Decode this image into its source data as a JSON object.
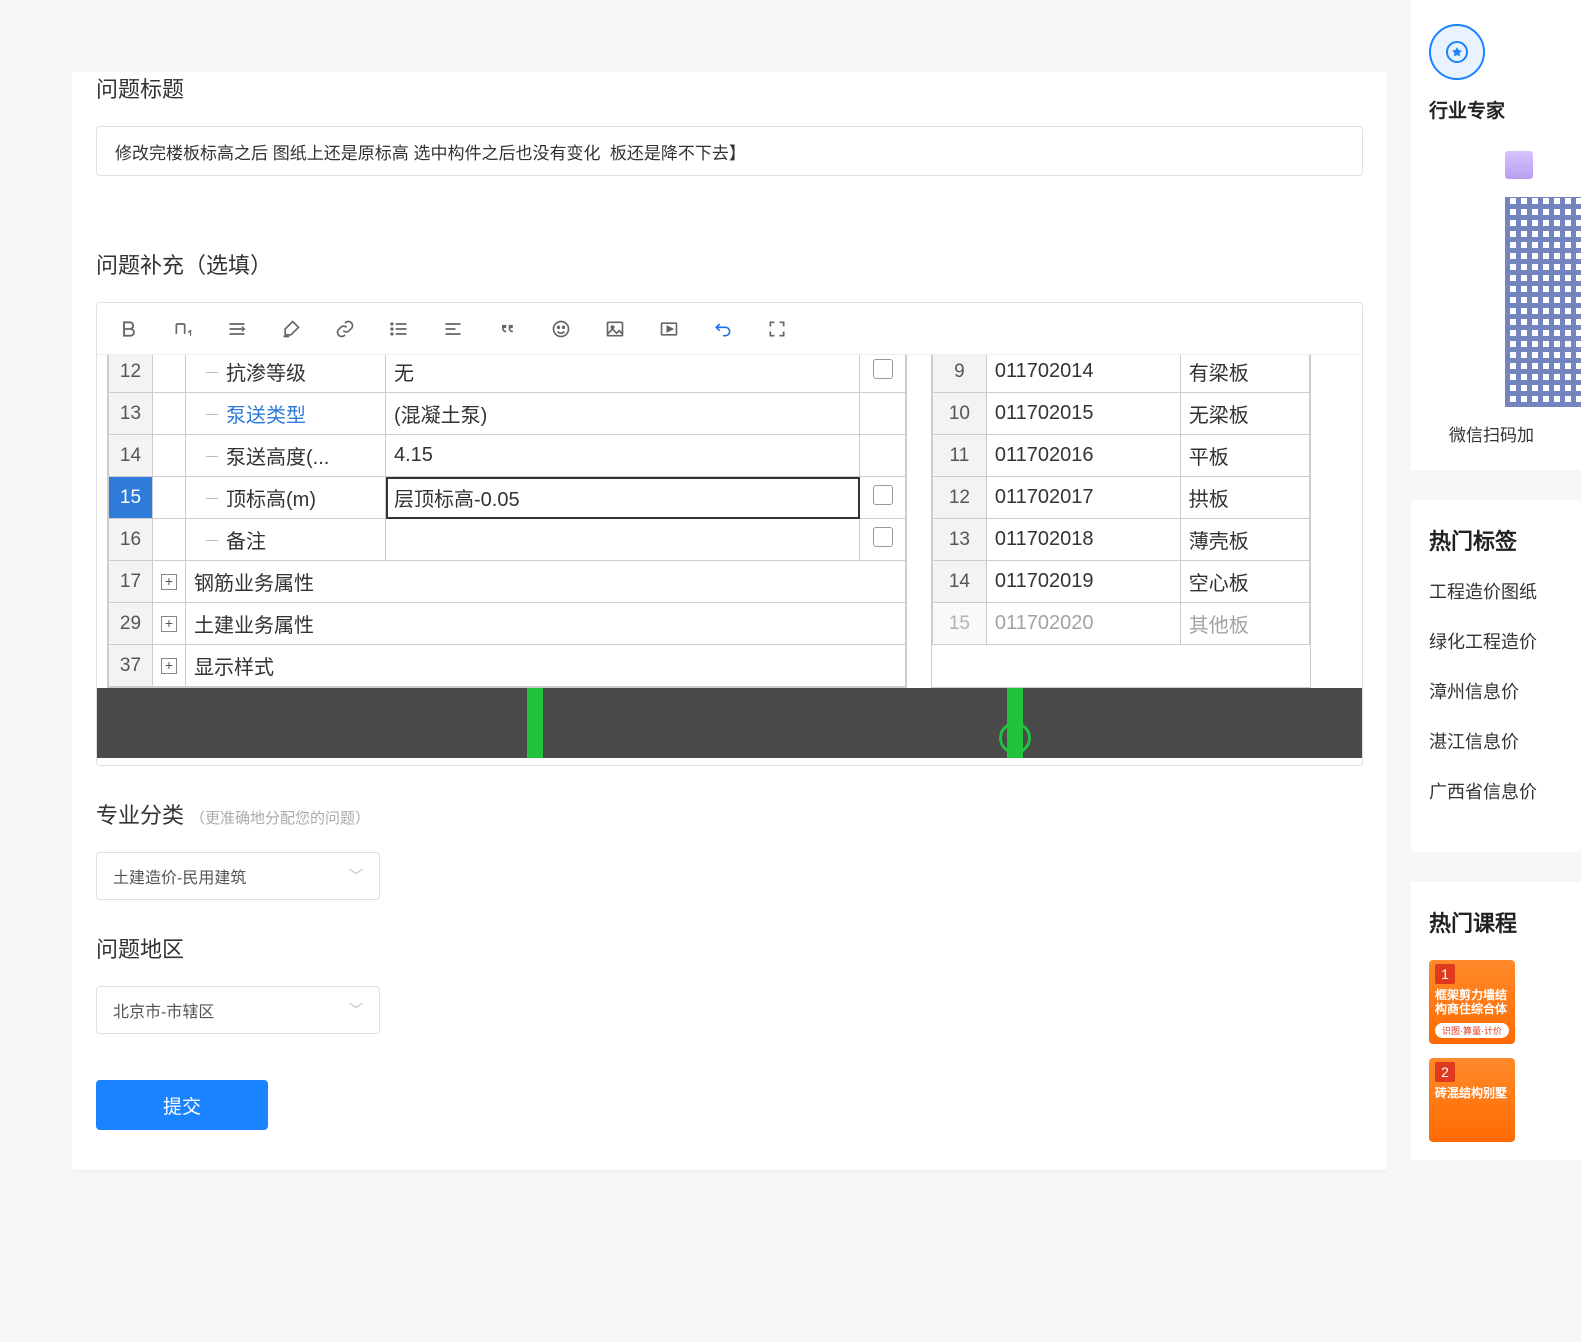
{
  "form": {
    "title_label": "问题标题",
    "title_value": "修改完楼板标高之后 图纸上还是原标高 选中构件之后也没有变化  板还是降不下去】",
    "supplement_label": "问题补充（选填）",
    "category_label": "专业分类",
    "category_hint": "（更准确地分配您的问题）",
    "category_value": "土建造价-民用建筑",
    "region_label": "问题地区",
    "region_value": "北京市-市辖区",
    "submit_label": "提交"
  },
  "editor_left_rows": [
    {
      "num": "12",
      "name": "抗渗等级",
      "val": "无",
      "chk": true
    },
    {
      "num": "13",
      "name": "泵送类型",
      "name_blue": true,
      "val": "(混凝土泵)",
      "chk": false
    },
    {
      "num": "14",
      "name": "泵送高度(...",
      "val": "4.15",
      "chk": false
    },
    {
      "num": "15",
      "name": "顶标高(m)",
      "val": "层顶标高-0.05",
      "sel": true,
      "chk": true
    },
    {
      "num": "16",
      "name": "备注",
      "val": "",
      "chk": true
    }
  ],
  "editor_left_groups": [
    {
      "num": "17",
      "name": "钢筋业务属性"
    },
    {
      "num": "29",
      "name": "土建业务属性"
    },
    {
      "num": "37",
      "name": "显示样式"
    }
  ],
  "editor_right_rows": [
    {
      "num": "9",
      "code": "011702014",
      "label": "有梁板"
    },
    {
      "num": "10",
      "code": "011702015",
      "label": "无梁板"
    },
    {
      "num": "11",
      "code": "011702016",
      "label": "平板"
    },
    {
      "num": "12",
      "code": "011702017",
      "label": "拱板"
    },
    {
      "num": "13",
      "code": "011702018",
      "label": "薄壳板"
    },
    {
      "num": "14",
      "code": "011702019",
      "label": "空心板"
    },
    {
      "num": "15",
      "code": "011702020",
      "label": "其他板",
      "faded": true
    }
  ],
  "badge_number": "2",
  "sidebar": {
    "expert_title": "行业专家",
    "qr_caption": "微信扫码加",
    "tags_title": "热门标签",
    "tags": [
      "工程造价图纸",
      "绿化工程造价",
      "漳州信息价",
      "湛江信息价",
      "广西省信息价"
    ],
    "courses_title": "热门课程",
    "courses": [
      {
        "num": "1",
        "t": "框架剪力墙结构商住综合体",
        "sub": "识图·算量·计价"
      },
      {
        "num": "2",
        "t": "砖混结构别墅",
        "sub": ""
      }
    ]
  }
}
